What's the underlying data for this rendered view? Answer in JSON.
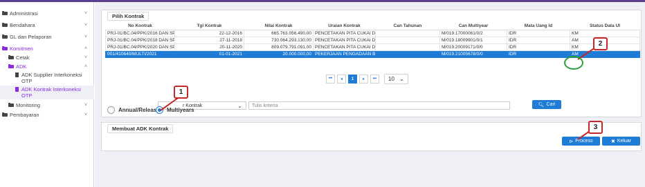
{
  "sidebar": {
    "items": [
      {
        "label": "Administrasi",
        "chevron": "˅"
      },
      {
        "label": "Bendahara",
        "chevron": "˅"
      },
      {
        "label": "GL dan Pelaporan",
        "chevron": "˅"
      },
      {
        "label": "Komitmen",
        "chevron": "˄"
      },
      {
        "label": "Cetak",
        "chevron": "˅"
      },
      {
        "label": "ADK",
        "chevron": "˄"
      },
      {
        "label": "ADK Supplier Interkoneksi OTP"
      },
      {
        "label": "ADK Kontrak Interkoneksi OTP"
      },
      {
        "label": "Monitoring",
        "chevron": "˅"
      },
      {
        "label": "Pembayaran",
        "chevron": "˅"
      }
    ]
  },
  "pilih_kontrak": {
    "title": "Pilih Kontrak",
    "columns": [
      "No Kontrak",
      "Tgl Kontrak",
      "Nilai Kontrak",
      "Uraian Kontrak",
      "Can Tahunan",
      "Can Multiyear",
      "Mata Uang Id",
      "Status Data UI"
    ],
    "rows": [
      [
        "PRJ-01/BC.04/PPK/2016 DAN SP-",
        "22-12-2016",
        "665.763.056.490,00",
        "PENCETAKAN PITA CUKAI DESAIN",
        "",
        "M/019.17000061/0/2",
        "IDR",
        "KM"
      ],
      [
        "PRJ-01/BC.04/PPK/2018 DAN SP-",
        "27-11-2018",
        "730.064.293.130,00",
        "PENCETAKAN PITA CUKAI DESAIN",
        "",
        "M/019.18009901/0/1",
        "IDR",
        "AM"
      ],
      [
        "PRJ-01/BC.04/PPK/2020 DAN SP-",
        "20-11-2020",
        "809.079.791.091,00",
        "PENCETAKAN PITA CUKAI DESAIN",
        "",
        "M/019.20009171/0/0",
        "IDR",
        "KM"
      ],
      [
        "001/410640/MULTI/2021",
        "01-01-2021",
        "20.000.000,00",
        "PEKERJAAN PENGADAAN BARANG",
        "",
        "M/019.21005678/0/0",
        "IDR",
        "AM"
      ]
    ],
    "selected_row": 3,
    "pager": {
      "first": "⏮",
      "prev": "◂",
      "current": "1",
      "next": "▸",
      "last": "⏭",
      "page_size": "10"
    },
    "filter_select": "Kontrak",
    "filter_select_partial": "r Kontrak",
    "search_placeholder": "Tulis kriteria",
    "search_button": "Cari",
    "radio_annual": "Annual/Release",
    "radio_multiyears": "Multiyears",
    "selected_radio": "multiyears"
  },
  "membuat": {
    "title": "Membuat ADK Kontrak",
    "process_label": "Process",
    "keluar_label": "Keluar"
  },
  "callouts": [
    "1",
    "2",
    "3"
  ],
  "colors": {
    "accent": "#1e7bd6",
    "callout": "#c62828",
    "highlight_circle": "#2e9e3a",
    "topbar": "#5b3e8e"
  }
}
